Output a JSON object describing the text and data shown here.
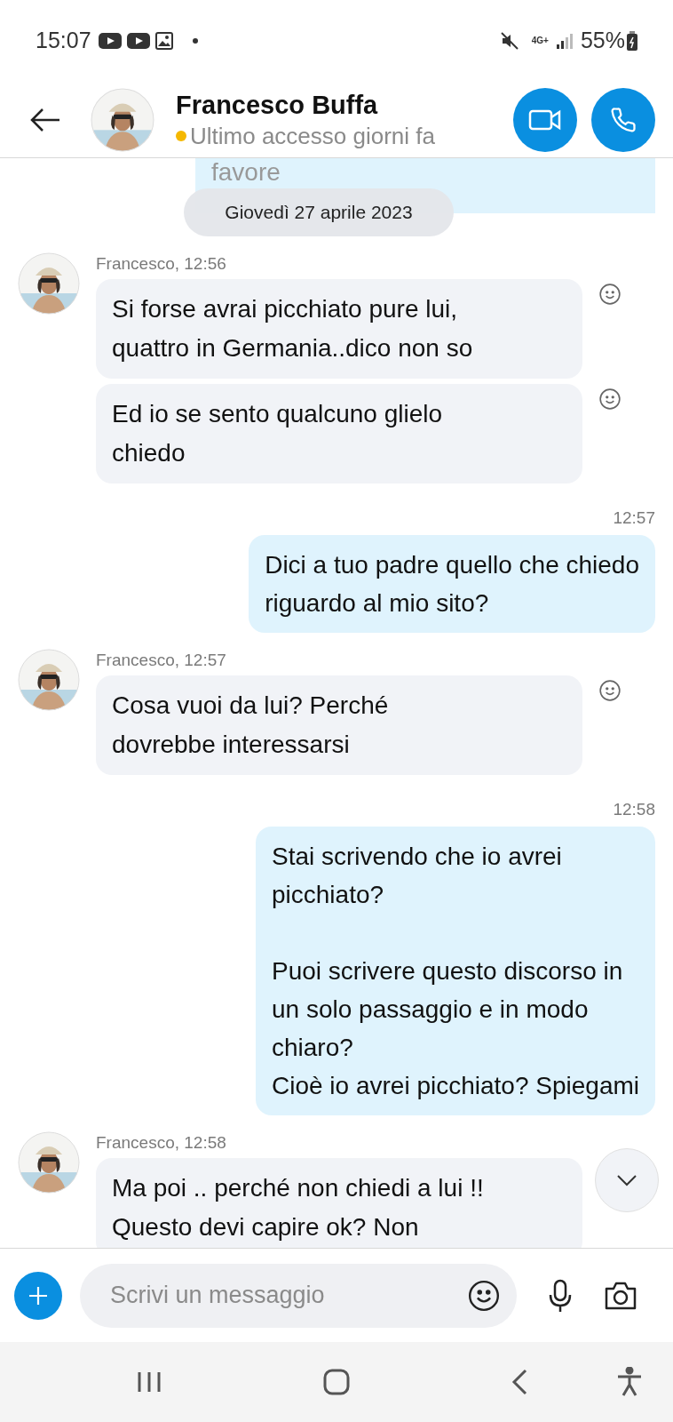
{
  "status_bar": {
    "time": "15:07",
    "battery": "55%",
    "network": "4G+"
  },
  "header": {
    "name": "Francesco Buffa",
    "presence": "Ultimo accesso giorni fa",
    "away": true
  },
  "partial_message": {
    "text": "favore"
  },
  "date_separator": "Giovedì 27 aprile 2023",
  "messages": [
    {
      "kind": "incoming",
      "sender_time": "Francesco, 12:56",
      "bubbles": [
        "Si forse avrai picchiato pure lui,\nquattro in Germania..dico non so",
        "Ed io se sento qualcuno glielo\nchiedo"
      ]
    },
    {
      "kind": "outgoing",
      "time": "12:57",
      "text": "Dici a tuo padre quello che chiedo\nriguardo al mio sito?"
    },
    {
      "kind": "incoming",
      "sender_time": "Francesco, 12:57",
      "bubbles": [
        "Cosa vuoi da lui? Perché\ndovrebbe interessarsi"
      ]
    },
    {
      "kind": "outgoing",
      "time": "12:58",
      "text": "Stai scrivendo che io avrei\npicchiato?\n\nPuoi scrivere questo discorso in\nun solo passaggio e in modo\nchiaro?\nCioè io avrei picchiato? Spiegami"
    },
    {
      "kind": "incoming",
      "sender_time": "Francesco, 12:58",
      "bubbles": [
        "Ma poi .. perché non chiedi a lui !!\nQuesto devi capire ok? Non"
      ]
    }
  ],
  "composer": {
    "placeholder": "Scrivi un messaggio"
  }
}
